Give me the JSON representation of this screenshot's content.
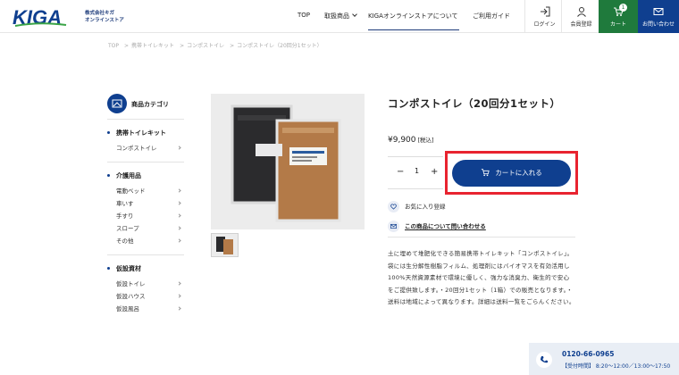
{
  "header": {
    "logo_text": "KIGA",
    "company_line1": "株式会社キガ",
    "company_line2": "オンラインストア",
    "nav": [
      {
        "label": "TOP"
      },
      {
        "label": "取扱商品"
      },
      {
        "label": "KIGAオンラインストアについて"
      },
      {
        "label": "ご利用ガイド"
      }
    ],
    "login_label": "ログイン",
    "member_label": "会員登録",
    "cart_label": "カート",
    "cart_count": "1",
    "contact_label": "お問い合わせ"
  },
  "breadcrumb": [
    "TOP",
    "携帯トイレキット",
    "コンポストイレ",
    "コンポストイレ（20回分1セット）"
  ],
  "breadcrumb_sep": ">",
  "sidebar": {
    "title": "商品カテゴリ",
    "groups": [
      {
        "title": "携帯トイレキット",
        "items": [
          "コンポストイレ"
        ]
      },
      {
        "title": "介護用品",
        "items": [
          "電動ベッド",
          "車いす",
          "手すり",
          "スロープ",
          "その他"
        ]
      },
      {
        "title": "仮設資材",
        "items": [
          "仮設トイレ",
          "仮設ハウス",
          "仮設風呂"
        ]
      }
    ]
  },
  "product": {
    "title": "コンポストイレ（20回分1セット）",
    "price": "¥9,900",
    "tax": "[税込]",
    "quantity": "1",
    "minus": "−",
    "plus": "+",
    "add_to_cart": "カートに入れる",
    "favorite": "お気に入り登録",
    "inquiry": "この商品について問い合わせる",
    "description": "土に埋めて堆肥化できる簡易携帯トイレキット「コンポストイレ」。袋には生分解性樹脂フィルム、処理剤にはバイオマスを有効活用し100%天然資源素材で環境に優しく、強力な消臭力、衛生的で安心をご提供致します。・20回分1セット（1箱）での販売となります。・送料は地域によって異なります。詳細は送料一覧をごらんください。"
  },
  "contact_box": {
    "phone": "0120-66-0965",
    "hours": "【受付時間】 8:20〜12:00／13:00〜17:50"
  },
  "colors": {
    "brand_blue": "#0f3f8f",
    "cart_green": "#1f7a3c",
    "highlight_red": "#e8232f"
  }
}
